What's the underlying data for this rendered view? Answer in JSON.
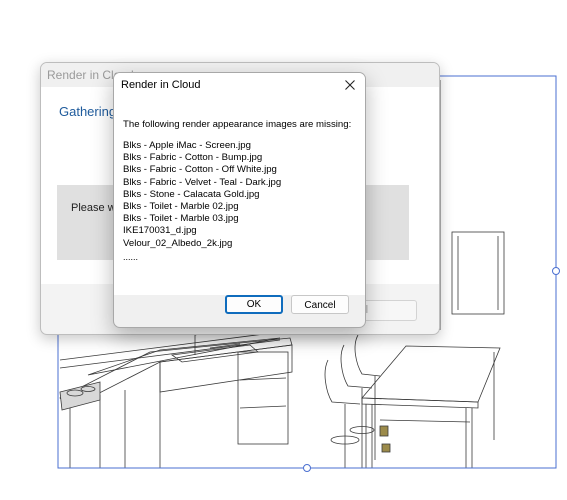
{
  "background_app": {
    "dialog_title": "Render in Cloud",
    "heading": "Gathering s",
    "status_text": "Please wa",
    "footer_button": "cel"
  },
  "dialog": {
    "title": "Render in Cloud",
    "message": "The following render appearance images are missing:",
    "missing_files": [
      "Blks - Apple iMac - Screen.jpg",
      "Blks - Fabric - Cotton - Bump.jpg",
      "Blks - Fabric - Cotton - Off White.jpg",
      "Blks - Fabric - Velvet - Teal - Dark.jpg",
      "Blks - Stone - Calacata Gold.jpg",
      "Blks - Toilet - Marble 02.jpg",
      "Blks - Toilet - Marble 03.jpg",
      "IKE170031_d.jpg",
      "Velour_02_Albedo_2k.jpg"
    ],
    "more_indicator": "......",
    "ok_label": "OK",
    "cancel_label": "Cancel",
    "close_icon": "close-icon"
  },
  "colors": {
    "accent": "#0f6cbd",
    "heading": "#1f5b9c",
    "selection": "#4a6fd1"
  }
}
